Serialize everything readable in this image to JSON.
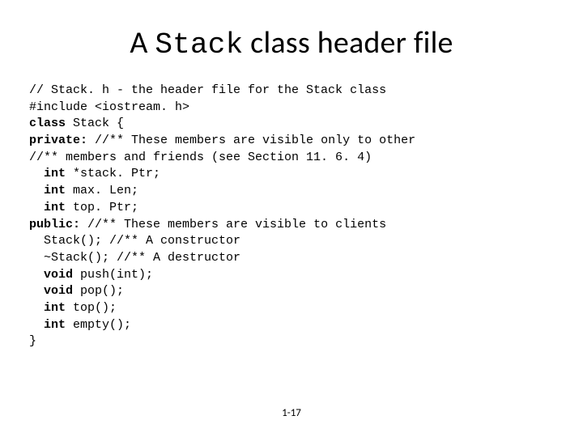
{
  "title_prefix": "A ",
  "title_mono": "Stack",
  "title_suffix": " class header file",
  "code": {
    "l1": "// Stack. h - the header file for the Stack class",
    "l2": "#include <iostream. h>",
    "l3a": "class",
    "l3b": " Stack {",
    "l4a": "private:",
    "l4b": " //** These members are visible only to other",
    "l5": "//** members and friends (see Section 11. 6. 4)",
    "l6a": "  int",
    "l6b": " *stack. Ptr;",
    "l7a": "  int",
    "l7b": " max. Len;",
    "l8a": "  int",
    "l8b": " top. Ptr;",
    "l9a": "public:",
    "l9b": " //** These members are visible to clients",
    "l10": "  Stack(); //** A constructor",
    "l11": "  ~Stack(); //** A destructor",
    "l12a": "  void",
    "l12b": " push(int);",
    "l13a": "  void",
    "l13b": " pop();",
    "l14a": "  int",
    "l14b": " top();",
    "l15a": "  int",
    "l15b": " empty();",
    "l16": "}"
  },
  "pagenum": "1-17"
}
